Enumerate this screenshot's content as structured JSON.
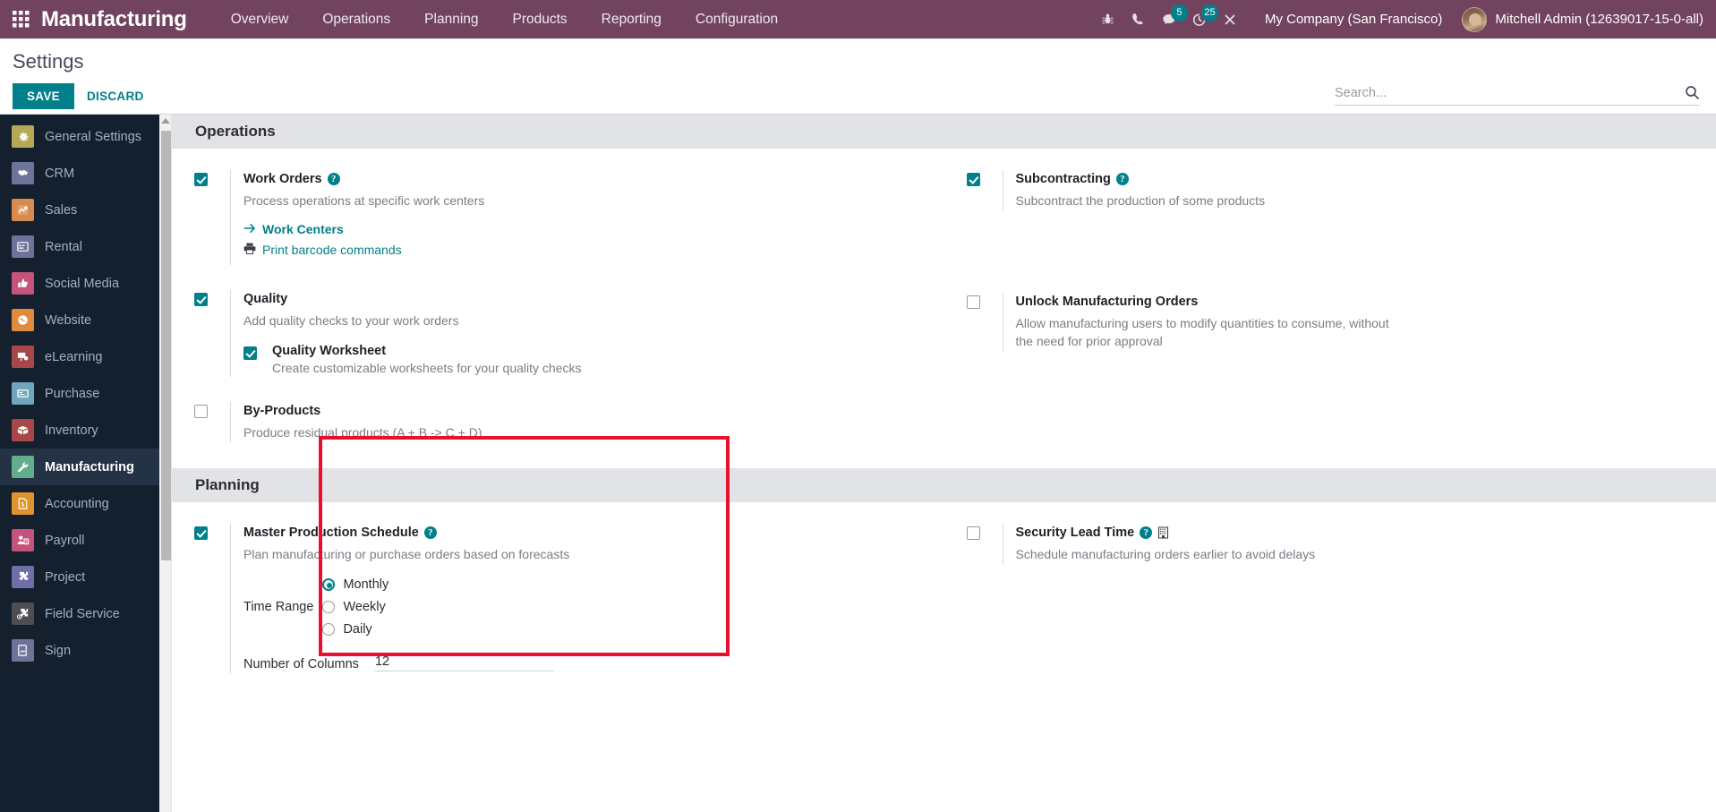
{
  "navbar": {
    "apps_icon": "apps-grid-icon",
    "brand": "Manufacturing",
    "menu": [
      {
        "label": "Overview"
      },
      {
        "label": "Operations"
      },
      {
        "label": "Planning"
      },
      {
        "label": "Products"
      },
      {
        "label": "Reporting"
      },
      {
        "label": "Configuration"
      }
    ],
    "sys_icons": [
      {
        "name": "bug-icon",
        "badge": ""
      },
      {
        "name": "phone-icon",
        "badge": ""
      },
      {
        "name": "messages-icon",
        "badge": "5"
      },
      {
        "name": "activities-clock-icon",
        "badge": "25"
      },
      {
        "name": "close-icon",
        "badge": ""
      }
    ],
    "company": "My Company (San Francisco)",
    "user": "Mitchell Admin (12639017-15-0-all)"
  },
  "control_panel": {
    "title": "Settings",
    "save_label": "SAVE",
    "discard_label": "DISCARD",
    "search_placeholder": "Search...",
    "search_value": ""
  },
  "sidebar": {
    "items": [
      {
        "label": "General Settings",
        "icon": "gear-icon",
        "color": "#b5a957",
        "active": false
      },
      {
        "label": "CRM",
        "icon": "handshake-icon",
        "color": "#6e7399",
        "active": false
      },
      {
        "label": "Sales",
        "icon": "chart-line-icon",
        "color": "#d98a4e",
        "active": false
      },
      {
        "label": "Rental",
        "icon": "calendar-icon",
        "color": "#6e7399",
        "active": false
      },
      {
        "label": "Social Media",
        "icon": "thumbs-up-icon",
        "color": "#c4547c",
        "active": false
      },
      {
        "label": "Website",
        "icon": "globe-icon",
        "color": "#e08a3c",
        "active": false
      },
      {
        "label": "eLearning",
        "icon": "presentation-icon",
        "color": "#a8474a",
        "active": false
      },
      {
        "label": "Purchase",
        "icon": "card-icon",
        "color": "#6fa8bc",
        "active": false
      },
      {
        "label": "Inventory",
        "icon": "box-icon",
        "color": "#a8474a",
        "active": false
      },
      {
        "label": "Manufacturing",
        "icon": "wrench-icon",
        "color": "#63ae8a",
        "active": true
      },
      {
        "label": "Accounting",
        "icon": "invoice-icon",
        "color": "#e0922f",
        "active": false
      },
      {
        "label": "Payroll",
        "icon": "person-money-icon",
        "color": "#c4547c",
        "active": false
      },
      {
        "label": "Project",
        "icon": "puzzle-icon",
        "color": "#6f6fa8",
        "active": false
      },
      {
        "label": "Field Service",
        "icon": "field-service-icon",
        "color": "#4d4d52",
        "active": false
      },
      {
        "label": "Sign",
        "icon": "sign-doc-icon",
        "color": "#6e7399",
        "active": false
      }
    ]
  },
  "sections": [
    {
      "id": "operations",
      "header": "Operations",
      "left": [
        {
          "name": "work-orders",
          "title": "Work Orders",
          "checked": true,
          "help": true,
          "desc": "Process operations at specific work centers",
          "links": [
            {
              "label": "Work Centers",
              "icon": "arrow-right-icon",
              "bold": true
            },
            {
              "label": "Print barcode commands",
              "icon": "printer-icon",
              "bold": false
            }
          ]
        },
        {
          "name": "quality",
          "title": "Quality",
          "checked": true,
          "help": false,
          "desc": "Add quality checks to your work orders",
          "sub": {
            "name": "quality-worksheet",
            "title": "Quality Worksheet",
            "checked": true,
            "desc": "Create customizable worksheets for your quality checks"
          }
        },
        {
          "name": "by-products",
          "title": "By-Products",
          "checked": false,
          "help": false,
          "desc": "Produce residual products (A + B -> C + D)"
        }
      ],
      "right": [
        {
          "name": "subcontracting",
          "title": "Subcontracting",
          "checked": true,
          "help": true,
          "desc": "Subcontract the production of some products"
        },
        {
          "name": "unlock-manufacturing-orders",
          "title": "Unlock Manufacturing Orders",
          "checked": false,
          "help": false,
          "desc": "Allow manufacturing users to modify quantities to consume, without the need for prior approval"
        }
      ]
    },
    {
      "id": "planning",
      "header": "Planning",
      "left": [
        {
          "name": "master-production-schedule",
          "title": "Master Production Schedule",
          "checked": true,
          "help": true,
          "desc": "Plan manufacturing or purchase orders based on forecasts",
          "time_range": {
            "label": "Time Range",
            "options": [
              {
                "label": "Monthly",
                "selected": true
              },
              {
                "label": "Weekly",
                "selected": false
              },
              {
                "label": "Daily",
                "selected": false
              }
            ]
          },
          "number_of_columns": {
            "label": "Number of Columns",
            "value": "12"
          }
        }
      ],
      "right": [
        {
          "name": "security-lead-time",
          "title": "Security Lead Time",
          "checked": false,
          "help": true,
          "building": true,
          "desc": "Schedule manufacturing orders earlier to avoid delays"
        }
      ]
    }
  ],
  "colors": {
    "navbar_bg": "#71435f",
    "accent": "#00808a",
    "sidebar_bg": "#14202e",
    "highlight": "#e8112d"
  }
}
